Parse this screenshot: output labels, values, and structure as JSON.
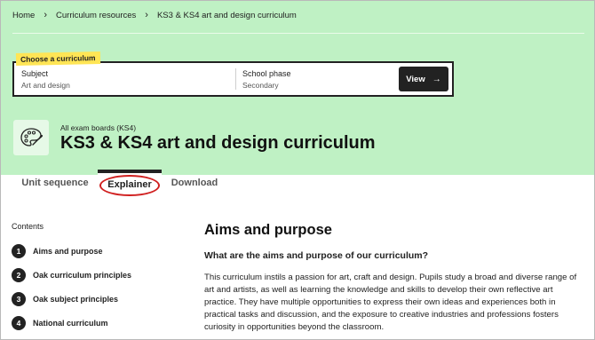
{
  "breadcrumb": {
    "items": [
      "Home",
      "Curriculum resources",
      "KS3 & KS4 art and design curriculum"
    ],
    "separator": "›"
  },
  "chooser": {
    "label": "Choose a curriculum",
    "subject": {
      "title": "Subject",
      "value": "Art and design"
    },
    "phase": {
      "title": "School phase",
      "value": "Secondary"
    },
    "view_label": "View",
    "view_arrow": "→"
  },
  "header": {
    "icon": "palette-icon",
    "exam_boards": "All exam boards (KS4)",
    "title": "KS3 & KS4 art and design curriculum"
  },
  "tabs": [
    {
      "label": "Unit sequence",
      "active": false
    },
    {
      "label": "Explainer",
      "active": true
    },
    {
      "label": "Download",
      "active": false
    }
  ],
  "contents": {
    "heading": "Contents",
    "items": [
      {
        "number": "1",
        "label": "Aims and purpose"
      },
      {
        "number": "2",
        "label": "Oak curriculum principles"
      },
      {
        "number": "3",
        "label": "Oak subject principles"
      },
      {
        "number": "4",
        "label": "National curriculum"
      }
    ]
  },
  "main": {
    "title": "Aims and purpose",
    "subtitle": "What are the aims and purpose of our curriculum?",
    "body": "This curriculum instils a passion for art, craft and design. Pupils study a broad and diverse range of art and artists, as well as learning the knowledge and skills to develop their own reflective art practice. They have multiple opportunities to express their own ideas and experiences both in practical tasks and discussion, and the exposure to creative industries and professions fosters curiosity in opportunities beyond the classroom."
  },
  "colors": {
    "hero_background": "#bff1c4",
    "label_highlight": "#ffe555",
    "annotation_ring": "#d02020",
    "button_dark": "#222222"
  }
}
